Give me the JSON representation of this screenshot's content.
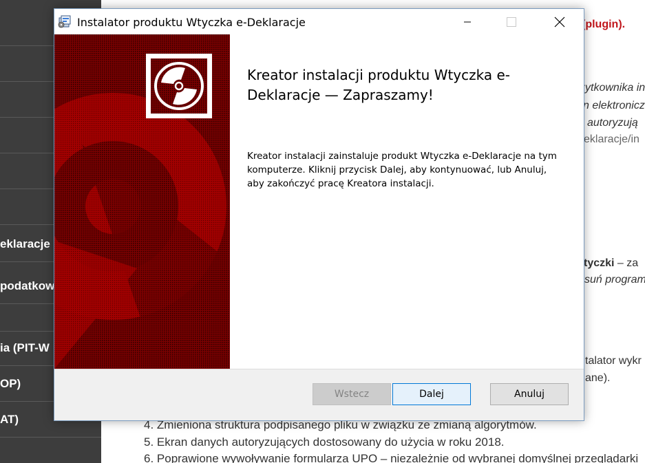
{
  "background_page": {
    "sidebar_items": [
      "",
      "",
      "",
      "",
      "",
      "",
      "eklaracje",
      "podatkow",
      "",
      "ia (PIT-W",
      "OP)",
      "AT)"
    ],
    "main_fragments": [
      {
        "text": "(plugin).",
        "style": "red"
      },
      {
        "text": "żytkownika in",
        "style": "italic"
      },
      {
        "text": "n elektronicz",
        "style": "italic"
      },
      {
        "text": "autoryzują",
        "style": "italic"
      },
      {
        "text": "eklaracje/in",
        "style": "muted"
      },
      {
        "text": "tyczki",
        "style": "bold"
      },
      {
        "text": " – za",
        "style": "plain"
      },
      {
        "text": "suń program",
        "style": "italic"
      },
      {
        "text": "talator wykr",
        "style": "plain"
      },
      {
        "text": "ane).",
        "style": "plain"
      }
    ],
    "list_items": [
      "4. Zmieniona struktura podpisanego pliku w związku ze zmianą algorytmów.",
      "5. Ekran danych autoryzujących dostosowany do użycia w roku 2018.",
      "6. Poprawione wywoływanie formularza UPO – niezależnie od wybranej domyślnej przeglądarki"
    ]
  },
  "window": {
    "title": "Instalator produktu Wtyczka e-Deklaracje",
    "heading": "Kreator instalacji produktu Wtyczka e-Deklaracje — Zapraszamy!",
    "body": "Kreator instalacji zainstaluje produkt Wtyczka e-Deklaracje na tym komputerze. Kliknij przycisk Dalej, aby kontynuować, lub Anuluj, aby zakończyć pracę Kreatora instalacji.",
    "buttons": {
      "back": "Wstecz",
      "next": "Dalej",
      "cancel": "Anuluj"
    },
    "icons": {
      "app": "installer-package-icon",
      "minimize": "minimize-icon",
      "maximize": "maximize-icon",
      "close": "close-icon",
      "banner": "disc-icon"
    },
    "colors": {
      "banner_red": "#8b0000",
      "banner_dark": "#3a0000",
      "accent_blue": "#0078d7"
    }
  }
}
